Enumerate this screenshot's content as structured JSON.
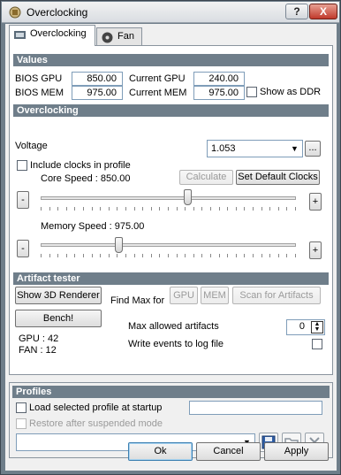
{
  "window": {
    "title": "Overclocking",
    "help_label": "?",
    "close_label": "X"
  },
  "tabs": [
    {
      "label": "Overclocking",
      "icon": "overclocking-icon"
    },
    {
      "label": "Fan",
      "icon": "fan-icon"
    }
  ],
  "values": {
    "header": "Values",
    "bios_gpu_label": "BIOS GPU",
    "bios_gpu": "850.00",
    "current_gpu_label": "Current GPU",
    "current_gpu": "240.00",
    "bios_mem_label": "BIOS MEM",
    "bios_mem": "975.00",
    "current_mem_label": "Current MEM",
    "current_mem": "975.00",
    "show_ddr_label": "Show as DDR",
    "show_ddr_checked": false
  },
  "overclocking": {
    "header": "Overclocking",
    "voltage_label": "Voltage",
    "voltage_value": "1.053",
    "voltage_more": "...",
    "include_clocks_label": "Include clocks in profile",
    "include_clocks_checked": false,
    "calculate_label": "Calculate",
    "set_default_label": "Set Default Clocks",
    "core_speed_label": "Core Speed : 850.00",
    "core_minus": "-",
    "core_plus": "+",
    "core_slider_fraction": 0.58,
    "memory_speed_label": "Memory Speed : 975.00",
    "mem_minus": "-",
    "mem_plus": "+",
    "mem_slider_fraction": 0.3
  },
  "artifact": {
    "header": "Artifact tester",
    "show_3d_label": "Show 3D Renderer",
    "find_max_label": "Find Max for",
    "gpu_btn": "GPU",
    "mem_btn": "MEM",
    "scan_btn": "Scan for Artifacts",
    "bench_label": "Bench!",
    "max_allowed_label": "Max allowed artifacts",
    "max_allowed_value": "0",
    "gpu_status": "GPU : 42",
    "fan_status": "FAN : 12",
    "write_events_label": "Write events to log file",
    "write_events_checked": false
  },
  "profiles": {
    "header": "Profiles",
    "load_selected_label": "Load selected profile at startup",
    "restore_label": "Restore after suspended mode",
    "save_icon": "save-icon",
    "open_icon": "open-folder-icon",
    "delete_icon": "delete-icon"
  },
  "footer": {
    "ok_label": "Ok",
    "cancel_label": "Cancel",
    "apply_label": "Apply"
  }
}
